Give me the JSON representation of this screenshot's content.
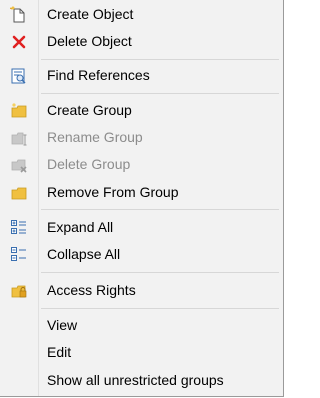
{
  "menu": {
    "items": [
      {
        "label": "Create Object",
        "icon": "new-document-icon",
        "enabled": true
      },
      {
        "label": "Delete Object",
        "icon": "red-x-delete-icon",
        "enabled": true
      },
      {
        "label": "Find References",
        "icon": "find-references-icon",
        "enabled": true
      },
      {
        "label": "Create Group",
        "icon": "new-folder-icon",
        "enabled": true
      },
      {
        "label": "Rename Group",
        "icon": "rename-folder-icon",
        "enabled": false
      },
      {
        "label": "Delete Group",
        "icon": "delete-folder-icon",
        "enabled": false
      },
      {
        "label": "Remove From Group",
        "icon": "folder-icon",
        "enabled": true
      },
      {
        "label": "Expand All",
        "icon": "expand-all-icon",
        "enabled": true
      },
      {
        "label": "Collapse All",
        "icon": "collapse-all-icon",
        "enabled": true
      },
      {
        "label": "Access Rights",
        "icon": "locked-folder-icon",
        "enabled": true
      },
      {
        "label": "View",
        "icon": "",
        "enabled": true
      },
      {
        "label": "Edit",
        "icon": "",
        "enabled": true
      },
      {
        "label": "Show all unrestricted groups",
        "icon": "",
        "enabled": true
      }
    ]
  },
  "colors": {
    "menu_background": "#f2f2f2",
    "disabled_text": "#8c8c8c",
    "folder": "#f0c040",
    "delete_red": "#e02020",
    "separator": "#d7d7d7"
  }
}
